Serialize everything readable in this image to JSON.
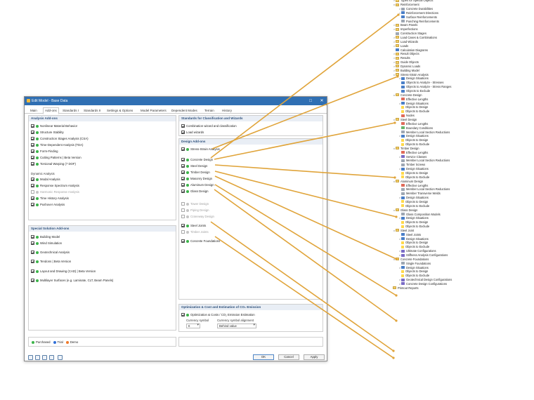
{
  "dialog": {
    "title": "Edit Model - Base Data",
    "tabs": [
      "Main",
      "Add-ons",
      "Standards I",
      "Standards II",
      "Settings & Options",
      "Model Parameters",
      "Dependent Modes",
      "Terrain",
      "History"
    ],
    "analysis_addons": {
      "header": "Analysis Add-ons",
      "items": [
        {
          "label": "Nonlinear Material Behavior",
          "checked": true,
          "dot": "green"
        },
        {
          "label": "Structure Stability",
          "checked": true,
          "dot": "green"
        },
        {
          "label": "Construction Stages Analysis (CSA)",
          "checked": true,
          "dot": "green"
        },
        {
          "label": "Time-Dependent Analysis (TDA)",
          "checked": true,
          "dot": "green"
        },
        {
          "label": "Form-Finding",
          "checked": true,
          "dot": "green"
        },
        {
          "label": "Cutting Patterns | Beta Version",
          "checked": true,
          "dot": "green"
        },
        {
          "label": "Torsional Warping (7 DOF)",
          "checked": true,
          "dot": "green"
        }
      ],
      "dynamic_label": "Dynamic Analysis",
      "dynamic_items": [
        {
          "label": "Modal Analysis",
          "checked": true,
          "dot": "green"
        },
        {
          "label": "Response Spectrum Analysis",
          "checked": true,
          "dot": "green"
        },
        {
          "label": "Harmonic Response Analysis",
          "checked": false,
          "dot": "gray"
        },
        {
          "label": "Time History Analysis",
          "checked": true,
          "dot": "green"
        },
        {
          "label": "Pushover Analysis",
          "checked": true,
          "dot": "green"
        }
      ]
    },
    "special_addons": {
      "header": "Special Solution Add-ons",
      "items": [
        {
          "label": "Building Model",
          "checked": true,
          "dot": "green"
        },
        {
          "label": "Wind Simulation",
          "checked": true,
          "dot": "green"
        },
        {
          "label": "Geotechnical Analysis",
          "checked": true,
          "dot": "green"
        },
        {
          "label": "Tendons | Beta Version",
          "checked": true,
          "dot": "green"
        },
        {
          "label": "Layout and Drawing (CAD) | Beta Version",
          "checked": true,
          "dot": "green"
        },
        {
          "label": "Multilayer Surfaces (e.g. Laminate, CLT, Beam Panels)",
          "checked": true,
          "dot": "green"
        }
      ]
    },
    "standards_wizards": {
      "header": "Standards for Classification and Wizards",
      "items": [
        {
          "label": "Combination wizard and classification",
          "checked": true
        },
        {
          "label": "Load wizards",
          "checked": true
        }
      ]
    },
    "design_addons": {
      "header": "Design Add-ons",
      "items": [
        {
          "label": "Stress-Strain Analysis",
          "checked": true,
          "dot": "green"
        },
        {
          "label": "Concrete Design",
          "checked": true,
          "dot": "green"
        },
        {
          "label": "Steel Design",
          "checked": true,
          "dot": "green"
        },
        {
          "label": "Timber Design",
          "checked": true,
          "dot": "green"
        },
        {
          "label": "Masonry Design",
          "checked": true,
          "dot": "green"
        },
        {
          "label": "Aluminum Design",
          "checked": true,
          "dot": "green"
        },
        {
          "label": "Glass Design",
          "checked": true,
          "dot": "green"
        }
      ],
      "dim_items": [
        {
          "label": "Tower Design"
        },
        {
          "label": "Piping Design"
        },
        {
          "label": "Craneway Design"
        }
      ],
      "joint_items": [
        {
          "label": "Steel Joints",
          "checked": true,
          "dot": "green"
        },
        {
          "label": "Timber Joints",
          "checked": false,
          "dot": "gray"
        }
      ],
      "foundation_item": {
        "label": "Concrete Foundations",
        "checked": true,
        "dot": "green"
      }
    },
    "optimization": {
      "header": "Optimization & Cost and Estimation of CO₂ Emission",
      "item_label": "Optimization & Costs / CO₂ Emission Estimation",
      "currency_symbol_label": "Currency symbol",
      "currency_alignment_label": "Currency symbol alignment",
      "currency_symbol_value": "€",
      "currency_alignment_value": "Behind value"
    },
    "legend": {
      "purchased": "Purchased",
      "trial": "Trial",
      "demo": "Demo"
    },
    "buttons": {
      "ok": "OK",
      "cancel": "Cancel",
      "apply": "Apply"
    },
    "colors": {
      "titlebar": "#2f6fb3",
      "purchased": "#3cb54a",
      "trial": "#2f6fd8",
      "demo": "#f07a2a",
      "leader": "#e0a43a"
    }
  },
  "navigator": {
    "items": [
      {
        "label": "Types for Special Objects",
        "level": 1,
        "icon": "folder",
        "arrow": ">"
      },
      {
        "label": "Reinforcement",
        "level": 1,
        "icon": "folder",
        "arrow": "v"
      },
      {
        "label": "Concrete Durabilities",
        "level": 2,
        "icon": "gray",
        "arrow": ">"
      },
      {
        "label": "Reinforcement Directions",
        "level": 2,
        "icon": "blue",
        "arrow": ">"
      },
      {
        "label": "Surface Reinforcements",
        "level": 2,
        "icon": "blue",
        "arrow": ""
      },
      {
        "label": "Punching Reinforcements",
        "level": 2,
        "icon": "gray",
        "arrow": ""
      },
      {
        "label": "Beam Panels",
        "level": 1,
        "icon": "folder",
        "arrow": ">"
      },
      {
        "label": "Imperfections",
        "level": 1,
        "icon": "folder",
        "arrow": ">"
      },
      {
        "label": "Construction Stages",
        "level": 1,
        "icon": "gray",
        "arrow": ""
      },
      {
        "label": "Load Cases & Combinations",
        "level": 1,
        "icon": "folder",
        "arrow": ">"
      },
      {
        "label": "Load Wizards",
        "level": 1,
        "icon": "folder",
        "arrow": ">"
      },
      {
        "label": "Loads",
        "level": 1,
        "icon": "folder",
        "arrow": ">"
      },
      {
        "label": "Calculation Diagrams",
        "level": 1,
        "icon": "blue",
        "arrow": ""
      },
      {
        "label": "Result Objects",
        "level": 1,
        "icon": "folder",
        "arrow": ">"
      },
      {
        "label": "Results",
        "level": 1,
        "icon": "folder",
        "arrow": ">"
      },
      {
        "label": "Guide Objects",
        "level": 1,
        "icon": "folder",
        "arrow": ">"
      },
      {
        "label": "Dynamic Loads",
        "level": 1,
        "icon": "folder",
        "arrow": ">"
      },
      {
        "label": "Building Model",
        "level": 1,
        "icon": "folder",
        "arrow": ">"
      },
      {
        "label": "Stress-Strain Analysis",
        "level": 1,
        "icon": "folder",
        "arrow": "v"
      },
      {
        "label": "Design Situations",
        "level": 2,
        "icon": "blue",
        "arrow": ">"
      },
      {
        "label": "Objects to Analyze - Stresses",
        "level": 2,
        "icon": "blue",
        "arrow": ""
      },
      {
        "label": "Objects to Analyze - Stress Ranges",
        "level": 2,
        "icon": "blue",
        "arrow": ""
      },
      {
        "label": "Objects to Exclude",
        "level": 2,
        "icon": "blue",
        "arrow": ""
      },
      {
        "label": "Concrete Design",
        "level": 1,
        "icon": "folder",
        "arrow": "v"
      },
      {
        "label": "Effective Lengths",
        "level": 2,
        "icon": "red",
        "arrow": ""
      },
      {
        "label": "Design Situations",
        "level": 2,
        "icon": "blue",
        "arrow": ">"
      },
      {
        "label": "Objects to Design",
        "level": 2,
        "icon": "doc",
        "arrow": ""
      },
      {
        "label": "Objects to Exclude",
        "level": 2,
        "icon": "doc",
        "arrow": ""
      },
      {
        "label": "Nodes",
        "level": 2,
        "icon": "red",
        "arrow": ""
      },
      {
        "label": "Steel Design",
        "level": 1,
        "icon": "folder",
        "arrow": "v"
      },
      {
        "label": "Effective Lengths",
        "level": 2,
        "icon": "red",
        "arrow": ""
      },
      {
        "label": "Boundary Conditions",
        "level": 2,
        "icon": "green",
        "arrow": ""
      },
      {
        "label": "Member Local Section Reductions",
        "level": 2,
        "icon": "gray",
        "arrow": ""
      },
      {
        "label": "Design Situations",
        "level": 2,
        "icon": "blue",
        "arrow": ">"
      },
      {
        "label": "Objects to Design",
        "level": 2,
        "icon": "doc",
        "arrow": ""
      },
      {
        "label": "Objects to Exclude",
        "level": 2,
        "icon": "doc",
        "arrow": ""
      },
      {
        "label": "Timber Design",
        "level": 1,
        "icon": "folder",
        "arrow": "v"
      },
      {
        "label": "Effective Lengths",
        "level": 2,
        "icon": "red",
        "arrow": ""
      },
      {
        "label": "Service Classes",
        "level": 2,
        "icon": "purple",
        "arrow": ">"
      },
      {
        "label": "Member Local Section Reductions",
        "level": 2,
        "icon": "gray",
        "arrow": ""
      },
      {
        "label": "Timber Screws",
        "level": 2,
        "icon": "gray",
        "arrow": ""
      },
      {
        "label": "Design Situations",
        "level": 2,
        "icon": "blue",
        "arrow": ">"
      },
      {
        "label": "Objects to Design",
        "level": 2,
        "icon": "doc",
        "arrow": ""
      },
      {
        "label": "Objects to Exclude",
        "level": 2,
        "icon": "doc",
        "arrow": ""
      },
      {
        "label": "Aluminum Design",
        "level": 1,
        "icon": "folder",
        "arrow": "v"
      },
      {
        "label": "Effective Lengths",
        "level": 2,
        "icon": "red",
        "arrow": ""
      },
      {
        "label": "Member Local Section Reductions",
        "level": 2,
        "icon": "gray",
        "arrow": ""
      },
      {
        "label": "Member Transverse Welds",
        "level": 2,
        "icon": "gray",
        "arrow": ""
      },
      {
        "label": "Design Situations",
        "level": 2,
        "icon": "blue",
        "arrow": ">"
      },
      {
        "label": "Objects to Design",
        "level": 2,
        "icon": "doc",
        "arrow": ""
      },
      {
        "label": "Objects to Exclude",
        "level": 2,
        "icon": "doc",
        "arrow": ""
      },
      {
        "label": "Glass Design",
        "level": 1,
        "icon": "folder",
        "arrow": "v"
      },
      {
        "label": "Glass Composition Models",
        "level": 2,
        "icon": "gray",
        "arrow": ""
      },
      {
        "label": "Design Situations",
        "level": 2,
        "icon": "blue",
        "arrow": ">"
      },
      {
        "label": "Objects to Design",
        "level": 2,
        "icon": "doc",
        "arrow": ""
      },
      {
        "label": "Objects to Exclude",
        "level": 2,
        "icon": "doc",
        "arrow": ""
      },
      {
        "label": "Steel Joint",
        "level": 1,
        "icon": "folder",
        "arrow": "v"
      },
      {
        "label": "Steel Joints",
        "level": 2,
        "icon": "blue",
        "arrow": ""
      },
      {
        "label": "Design Situations",
        "level": 2,
        "icon": "blue",
        "arrow": ">"
      },
      {
        "label": "Objects to Design",
        "level": 2,
        "icon": "doc",
        "arrow": ""
      },
      {
        "label": "Objects to Exclude",
        "level": 2,
        "icon": "doc",
        "arrow": ""
      },
      {
        "label": "Ultimate Configurations",
        "level": 2,
        "icon": "purple",
        "arrow": ">"
      },
      {
        "label": "Stiffness Analysis Configurations",
        "level": 2,
        "icon": "purple",
        "arrow": ">"
      },
      {
        "label": "Concrete Foundations",
        "level": 1,
        "icon": "folder",
        "arrow": "v"
      },
      {
        "label": "Single Foundations",
        "level": 2,
        "icon": "gray",
        "arrow": ""
      },
      {
        "label": "Design Situations",
        "level": 2,
        "icon": "blue",
        "arrow": ">"
      },
      {
        "label": "Objects to Design",
        "level": 2,
        "icon": "doc",
        "arrow": ""
      },
      {
        "label": "Objects to Exclude",
        "level": 2,
        "icon": "doc",
        "arrow": ""
      },
      {
        "label": "Geotechnical Design Configurations",
        "level": 2,
        "icon": "purple",
        "arrow": ">"
      },
      {
        "label": "Concrete Design Configurations",
        "level": 2,
        "icon": "purple",
        "arrow": ">"
      },
      {
        "label": "Printout Reports",
        "level": 0,
        "icon": "folder",
        "arrow": ""
      }
    ]
  }
}
